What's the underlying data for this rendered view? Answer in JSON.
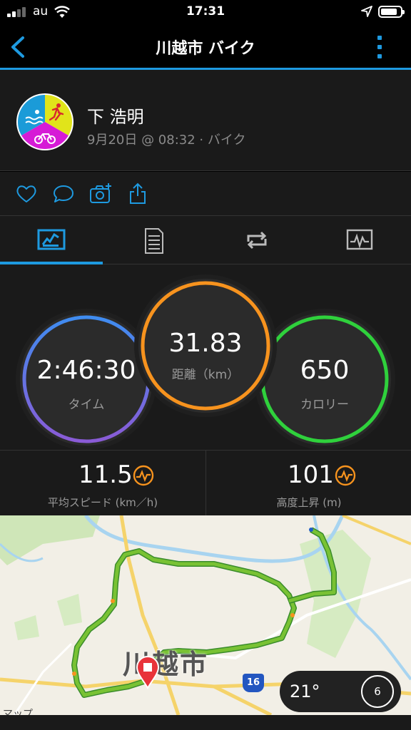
{
  "status_bar": {
    "carrier": "au",
    "time": "17:31",
    "battery_level": 0.85
  },
  "nav": {
    "title": "川越市 バイク",
    "back_icon": "chevron-left-icon",
    "more_icon": "more-vertical-icon"
  },
  "header": {
    "name": "下 浩明",
    "meta": "9月20日 @ 08:32 · バイク",
    "avatar_colors": [
      "#1b9bd8",
      "#e1e41a",
      "#d61bd6"
    ]
  },
  "actions": [
    {
      "icon": "heart-icon"
    },
    {
      "icon": "comment-icon"
    },
    {
      "icon": "add-photo-icon"
    },
    {
      "icon": "share-icon"
    }
  ],
  "tabs": [
    {
      "icon": "overview-icon",
      "active": true
    },
    {
      "icon": "details-icon",
      "active": false
    },
    {
      "icon": "laps-icon",
      "active": false
    },
    {
      "icon": "charts-icon",
      "active": false
    }
  ],
  "stats": {
    "time": {
      "value": "2:46:30",
      "label": "タイム"
    },
    "distance": {
      "value": "31.83",
      "label": "距離（km）"
    },
    "calories": {
      "value": "650",
      "label": "カロリー"
    }
  },
  "substats": [
    {
      "value": "11.5",
      "label": "平均スピード (km／h)",
      "icon": "gauge-icon"
    },
    {
      "value": "101",
      "label": "高度上昇 (m)",
      "icon": "gauge-icon"
    }
  ],
  "map": {
    "city_label": "川越市",
    "credit": "マップ",
    "road_number": "16",
    "temperature": "21°",
    "wind_speed": "6"
  },
  "colors": {
    "accent": "#1e9ae0",
    "time_ring": [
      "#3f8cf0",
      "#8a5bd6"
    ],
    "distance_ring": "#f7931e",
    "calories_ring": "#2fd13c",
    "gauge": "#f7931e"
  }
}
